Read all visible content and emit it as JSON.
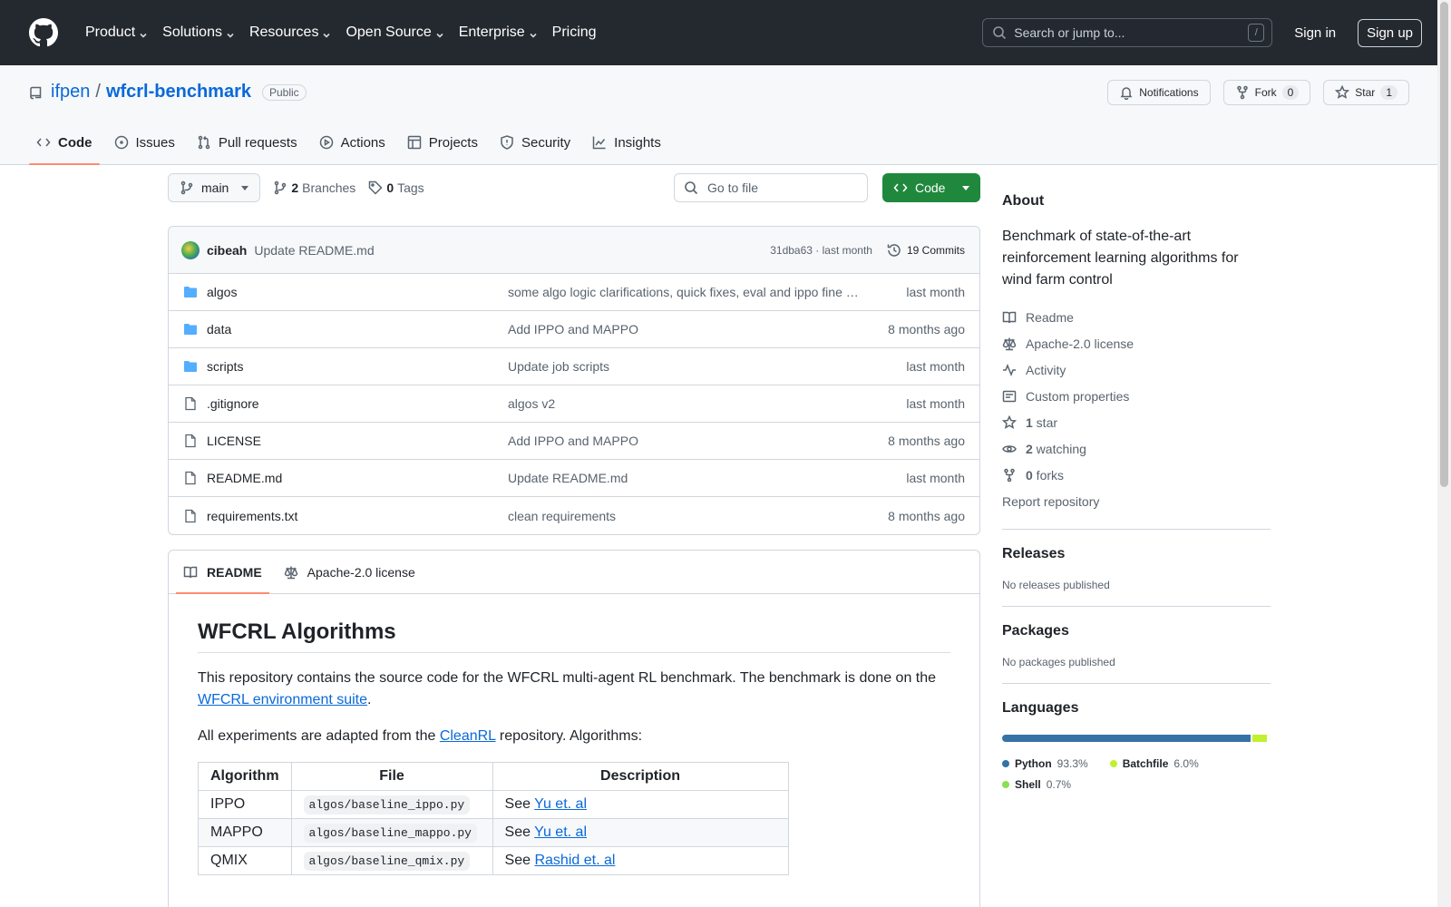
{
  "header": {
    "nav": [
      "Product",
      "Solutions",
      "Resources",
      "Open Source",
      "Enterprise",
      "Pricing"
    ],
    "search_placeholder": "Search or jump to...",
    "search_key": "/",
    "sign_in": "Sign in",
    "sign_up": "Sign up"
  },
  "repo": {
    "owner": "ifpen",
    "separator": "/",
    "name": "wfcrl-benchmark",
    "visibility": "Public",
    "notifications_label": "Notifications",
    "fork_label": "Fork",
    "fork_count": "0",
    "star_label": "Star",
    "star_count": "1",
    "tabs": [
      "Code",
      "Issues",
      "Pull requests",
      "Actions",
      "Projects",
      "Security",
      "Insights"
    ]
  },
  "filenav": {
    "branch": "main",
    "branches_count": "2",
    "branches_label": "Branches",
    "tags_count": "0",
    "tags_label": "Tags",
    "goto_placeholder": "Go to file",
    "code_label": "Code"
  },
  "commit": {
    "author": "cibeah",
    "message": "Update README.md",
    "meta": "31dba63 · last month",
    "commits_label": "19 Commits"
  },
  "files": [
    {
      "name": "algos",
      "type": "dir",
      "commit": "some algo logic clarifications, quick fixes, eval and ippo fine tuning",
      "time": "last month"
    },
    {
      "name": "data",
      "type": "dir",
      "commit": "Add IPPO and MAPPO",
      "time": "8 months ago"
    },
    {
      "name": "scripts",
      "type": "dir",
      "commit": "Update job scripts",
      "time": "last month"
    },
    {
      "name": ".gitignore",
      "type": "file",
      "commit": "algos v2",
      "time": "last month"
    },
    {
      "name": "LICENSE",
      "type": "file",
      "commit": "Add IPPO and MAPPO",
      "time": "8 months ago"
    },
    {
      "name": "README.md",
      "type": "file",
      "commit": "Update README.md",
      "time": "last month"
    },
    {
      "name": "requirements.txt",
      "type": "file",
      "commit": "clean requirements",
      "time": "8 months ago"
    }
  ],
  "readme": {
    "tab_readme": "README",
    "tab_license": "Apache-2.0 license",
    "title": "WFCRL Algorithms",
    "p1_text": "This repository contains the source code for the WFCRL multi-agent RL benchmark. The benchmark is done on the ",
    "p1_link": "WFCRL environment suite",
    "p1_end": ".",
    "p2_text": "All experiments are adapted from the ",
    "p2_link": "CleanRL",
    "p2_end": " repository. Algorithms:",
    "table_headers": [
      "Algorithm",
      "File",
      "Description"
    ],
    "table_rows": [
      {
        "algo": "IPPO",
        "file": "algos/baseline_ippo.py",
        "see": "See ",
        "link": "Yu et. al"
      },
      {
        "algo": "MAPPO",
        "file": "algos/baseline_mappo.py",
        "see": "See ",
        "link": "Yu et. al"
      },
      {
        "algo": "QMIX",
        "file": "algos/baseline_qmix.py",
        "see": "See ",
        "link": "Rashid et. al"
      }
    ]
  },
  "about": {
    "heading": "About",
    "description": "Benchmark of state-of-the-art reinforcement learning algorithms for wind farm control",
    "readme": "Readme",
    "license": "Apache-2.0 license",
    "activity": "Activity",
    "custom_props": "Custom properties",
    "stars_count": "1",
    "stars_label": " star",
    "watching_count": "2",
    "watching_label": " watching",
    "forks_count": "0",
    "forks_label": " forks",
    "report": "Report repository"
  },
  "releases": {
    "heading": "Releases",
    "empty": "No releases published"
  },
  "packages": {
    "heading": "Packages",
    "empty": "No packages published"
  },
  "languages": {
    "heading": "Languages",
    "items": [
      {
        "name": "Python",
        "pct": "93.3%",
        "value": 93.3,
        "color": "#3572A5"
      },
      {
        "name": "Batchfile",
        "pct": "6.0%",
        "value": 6.0,
        "color": "#C1F12E"
      },
      {
        "name": "Shell",
        "pct": "0.7%",
        "value": 0.7,
        "color": "#89e051"
      }
    ]
  }
}
